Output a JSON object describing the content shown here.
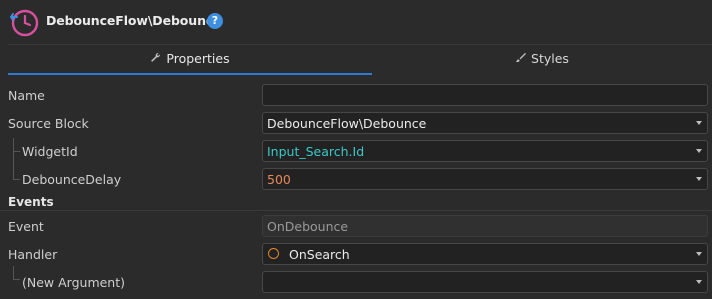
{
  "header": {
    "title": "DebounceFlow\\Debounce",
    "help_label": "?"
  },
  "tabs": [
    {
      "label": "Properties",
      "icon": "wrench-icon",
      "active": true
    },
    {
      "label": "Styles",
      "icon": "brush-icon",
      "active": false
    }
  ],
  "properties": {
    "name_label": "Name",
    "name_value": "",
    "source_block_label": "Source Block",
    "source_block_value": "DebounceFlow\\Debounce",
    "widget_id_label": "WidgetId",
    "widget_id_value": "Input_Search.Id",
    "debounce_delay_label": "DebounceDelay",
    "debounce_delay_value": "500"
  },
  "events": {
    "section_label": "Events",
    "event_label": "Event",
    "event_value": "OnDebounce",
    "handler_label": "Handler",
    "handler_value": "OnSearch",
    "new_argument_label": "(New Argument)",
    "new_argument_value": ""
  },
  "colors": {
    "accent": "#2f7ad3",
    "expression_text": "#3ec7c7",
    "number_text": "#e8875a",
    "handler_circle": "#e08a2a",
    "logo": "#d94fa0"
  }
}
